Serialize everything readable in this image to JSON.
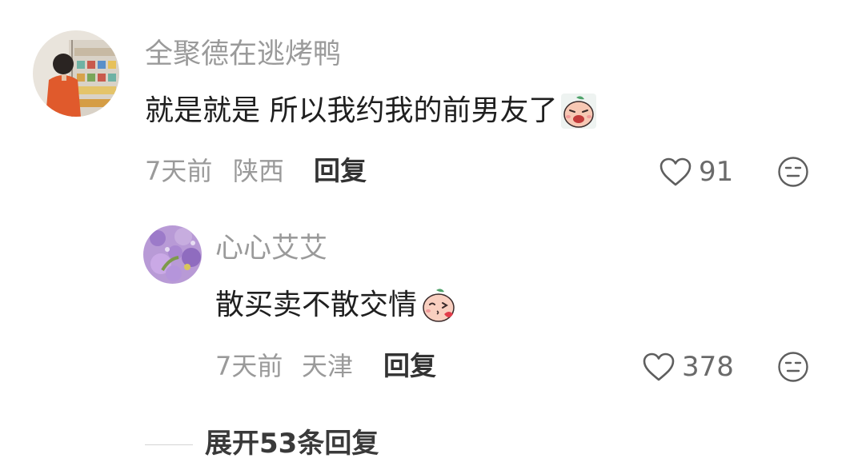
{
  "comments": [
    {
      "username": "全聚德在逃烤鸭",
      "text": "就是就是 所以我约我的前男友了",
      "emoji": "crying-peach-emoji",
      "time": "7天前",
      "location": "陕西",
      "reply_label": "回复",
      "likes": "91"
    },
    {
      "username": "心心艾艾",
      "text": "散买卖不散交情",
      "emoji": "kissing-peach-emoji",
      "time": "7天前",
      "location": "天津",
      "reply_label": "回复",
      "likes": "378"
    }
  ],
  "expand_replies": "展开53条回复",
  "icons": {
    "like": "heart-outline-icon",
    "dislike": "neutral-face-icon"
  }
}
